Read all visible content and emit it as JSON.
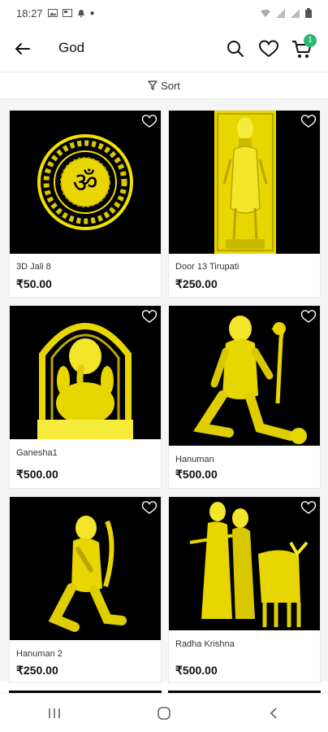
{
  "status_bar": {
    "time": "18:27"
  },
  "header": {
    "title": "God",
    "cart_count": "1"
  },
  "sort": {
    "label": "Sort"
  },
  "products": [
    {
      "name": "3D Jali 8",
      "price": "₹50.00",
      "art": "om-medallion"
    },
    {
      "name": "Door 13 Tirupati",
      "price": "₹250.00",
      "art": "tirupati-panel"
    },
    {
      "name": "Ganesha1",
      "price": "₹500.00",
      "art": "ganesha"
    },
    {
      "name": "Hanuman",
      "price": "₹500.00",
      "art": "hanuman-kneeling"
    },
    {
      "name": "Hanuman 2",
      "price": "₹250.00",
      "art": "hanuman-praying"
    },
    {
      "name": "Radha Krishna",
      "price": "₹500.00",
      "art": "radha-krishna-cow"
    }
  ],
  "colors": {
    "accent": "#2bb673",
    "gold": "#f2e100",
    "gold_dark": "#b8a600"
  }
}
